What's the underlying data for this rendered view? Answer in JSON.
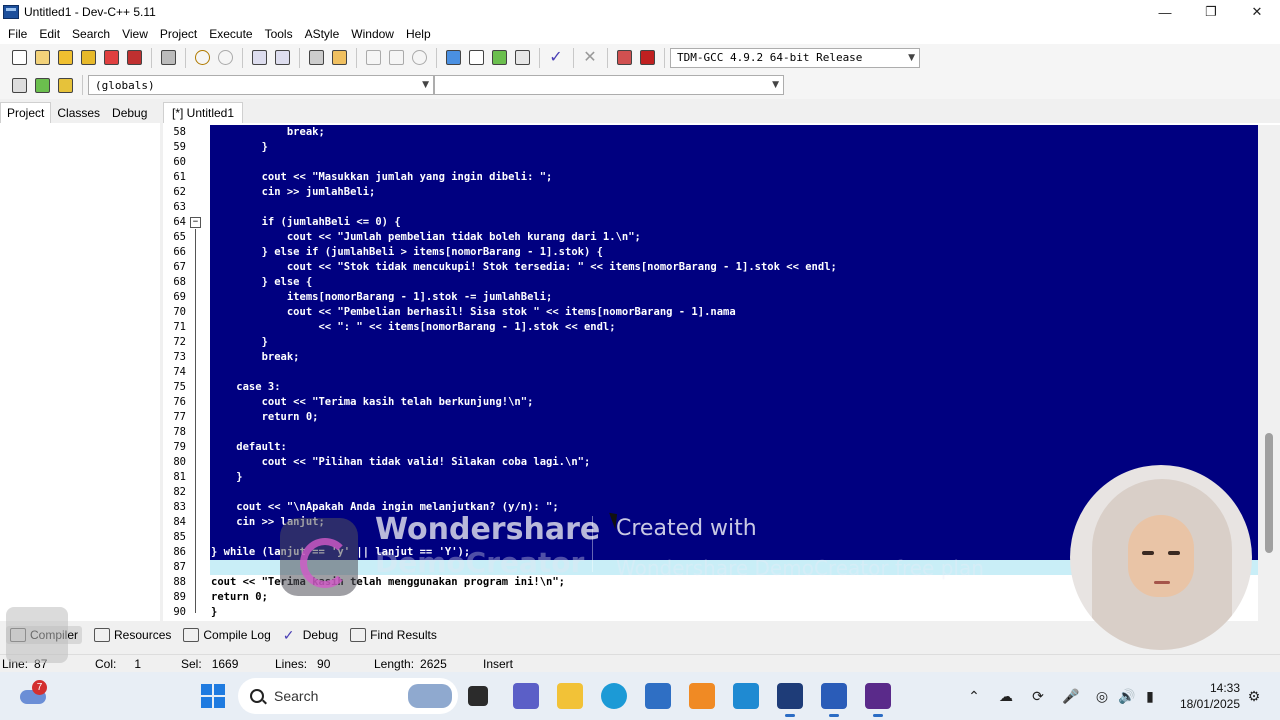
{
  "window": {
    "title": "Untitled1 - Dev-C++ 5.11"
  },
  "menu": [
    "File",
    "Edit",
    "Search",
    "View",
    "Project",
    "Execute",
    "Tools",
    "AStyle",
    "Window",
    "Help"
  ],
  "toolbar": {
    "compiler": "TDM-GCC 4.9.2 64-bit Release",
    "scope": "(globals)",
    "symbol": ""
  },
  "left_tabs": [
    "Project",
    "Classes",
    "Debug"
  ],
  "editor_tab": "[*] Untitled1",
  "code_lines": [
    {
      "n": "58",
      "text": "            break;",
      "state": "sel"
    },
    {
      "n": "59",
      "text": "        }",
      "state": "sel"
    },
    {
      "n": "60",
      "text": "",
      "state": "sel"
    },
    {
      "n": "61",
      "text": "        cout << \"Masukkan jumlah yang ingin dibeli: \";",
      "state": "sel"
    },
    {
      "n": "62",
      "text": "        cin >> jumlahBeli;",
      "state": "sel"
    },
    {
      "n": "63",
      "text": "",
      "state": "sel"
    },
    {
      "n": "64",
      "text": "        if (jumlahBeli <= 0) {",
      "state": "sel"
    },
    {
      "n": "65",
      "text": "            cout << \"Jumlah pembelian tidak boleh kurang dari 1.\\n\";",
      "state": "sel"
    },
    {
      "n": "66",
      "text": "        } else if (jumlahBeli > items[nomorBarang - 1].stok) {",
      "state": "sel"
    },
    {
      "n": "67",
      "text": "            cout << \"Stok tidak mencukupi! Stok tersedia: \" << items[nomorBarang - 1].stok << endl;",
      "state": "sel"
    },
    {
      "n": "68",
      "text": "        } else {",
      "state": "sel"
    },
    {
      "n": "69",
      "text": "            items[nomorBarang - 1].stok -= jumlahBeli;",
      "state": "sel"
    },
    {
      "n": "70",
      "text": "            cout << \"Pembelian berhasil! Sisa stok \" << items[nomorBarang - 1].nama",
      "state": "sel"
    },
    {
      "n": "71",
      "text": "                 << \": \" << items[nomorBarang - 1].stok << endl;",
      "state": "sel"
    },
    {
      "n": "72",
      "text": "        }",
      "state": "sel"
    },
    {
      "n": "73",
      "text": "        break;",
      "state": "sel"
    },
    {
      "n": "74",
      "text": "",
      "state": "sel"
    },
    {
      "n": "75",
      "text": "    case 3:",
      "state": "sel"
    },
    {
      "n": "76",
      "text": "        cout << \"Terima kasih telah berkunjung!\\n\";",
      "state": "sel"
    },
    {
      "n": "77",
      "text": "        return 0;",
      "state": "sel"
    },
    {
      "n": "78",
      "text": "",
      "state": "sel"
    },
    {
      "n": "79",
      "text": "    default:",
      "state": "sel"
    },
    {
      "n": "80",
      "text": "        cout << \"Pilihan tidak valid! Silakan coba lagi.\\n\";",
      "state": "sel"
    },
    {
      "n": "81",
      "text": "    }",
      "state": "sel"
    },
    {
      "n": "82",
      "text": "",
      "state": "sel"
    },
    {
      "n": "83",
      "text": "    cout << \"\\nApakah Anda ingin melanjutkan? (y/n): \";",
      "state": "sel"
    },
    {
      "n": "84",
      "text": "    cin >> lanjut;",
      "state": "sel"
    },
    {
      "n": "85",
      "text": "",
      "state": "sel"
    },
    {
      "n": "86",
      "text": "} while (lanjut == 'y' || lanjut == 'Y');",
      "state": "sel"
    },
    {
      "n": "87",
      "text": "",
      "state": "cur"
    },
    {
      "n": "88",
      "text": "cout << \"Terima kasih telah menggunakan program ini!\\n\";",
      "state": "plain"
    },
    {
      "n": "89",
      "text": "return 0;",
      "state": "plain"
    },
    {
      "n": "90",
      "text": "}",
      "state": "plain"
    }
  ],
  "bottom_tabs": [
    "Compiler",
    "Resources",
    "Compile Log",
    "Debug",
    "Find Results"
  ],
  "status": {
    "line_label": "Line:",
    "line": "87",
    "col_label": "Col:",
    "col": "1",
    "sel_label": "Sel:",
    "sel": "1669",
    "lines_label": "Lines:",
    "lines": "90",
    "length_label": "Length:",
    "length": "2625",
    "mode": "Insert"
  },
  "taskbar": {
    "search": "Search",
    "time": "14:33",
    "date": "18/01/2025",
    "weather_badge": "7"
  },
  "watermark": {
    "brand": "Wondershare",
    "brand2": "DemoCreator",
    "created": "Created with",
    "free": "Wondershare DemoCreator free plan"
  },
  "colors": {
    "selection": "#000080",
    "current_line": "#c9eef7",
    "string": "#0000ff",
    "accent": "#2b6cc4"
  }
}
